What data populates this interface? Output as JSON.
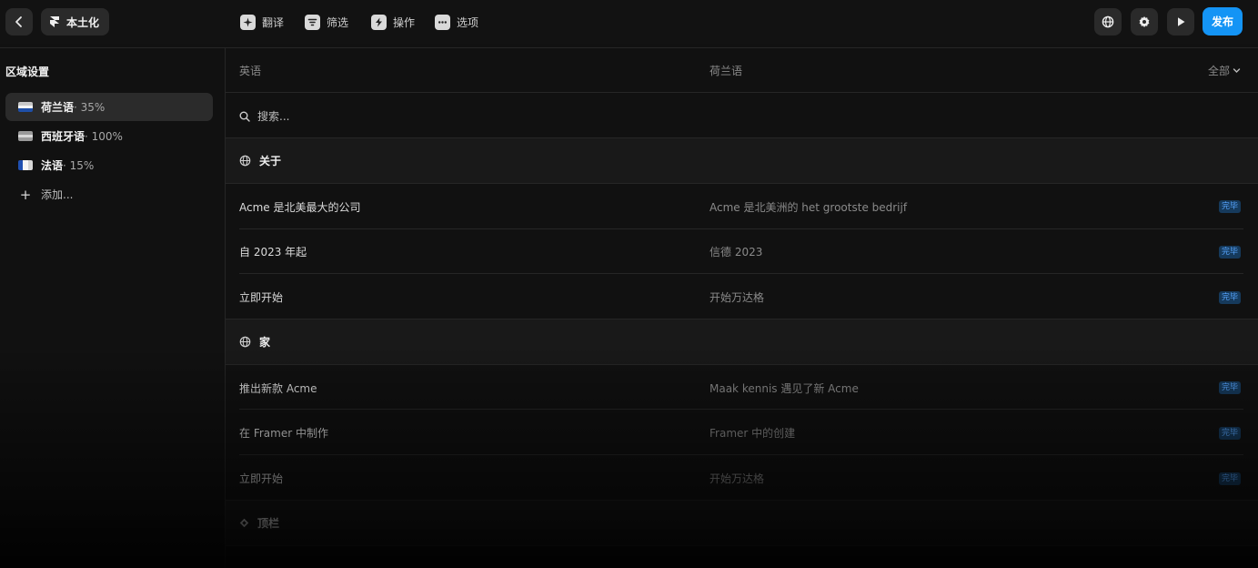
{
  "header": {
    "title": "本土化",
    "tools": [
      "翻译",
      "筛选",
      "操作",
      "选项"
    ],
    "publish_label": "发布"
  },
  "sidebar": {
    "title": "区域设置",
    "items": [
      {
        "name": "荷兰语",
        "pct": "· 35%"
      },
      {
        "name": "西班牙语",
        "pct": "· 100%"
      },
      {
        "name": "法语",
        "pct": "· 15%"
      }
    ],
    "add_label": "添加..."
  },
  "table": {
    "col_source": "英语",
    "col_target": "荷兰语",
    "filter": "全部",
    "search_placeholder": "搜索..."
  },
  "groups": [
    {
      "title": "关于",
      "rows": [
        {
          "source": "Acme 是北美最大的公司",
          "target": "Acme 是北美洲的 het grootste bedrijf",
          "status": "完毕"
        },
        {
          "source": "自 2023 年起",
          "target": "信德 2023",
          "status": "完毕"
        },
        {
          "source": "立即开始",
          "target": "开始万达格",
          "status": "完毕"
        }
      ]
    },
    {
      "title": "家",
      "rows": [
        {
          "source": "推出新款 Acme",
          "target": "Maak kennis 遇见了新 Acme",
          "status": "完毕"
        },
        {
          "source": "在 Framer 中制作",
          "target": "Framer 中的创建",
          "status": "完毕"
        },
        {
          "source": "立即开始",
          "target": "开始万达格",
          "status": "完毕"
        }
      ]
    },
    {
      "title": "顶栏",
      "rows": []
    }
  ],
  "colors": {
    "accent": "#1494f5",
    "badge_text": "#58a6ff"
  }
}
